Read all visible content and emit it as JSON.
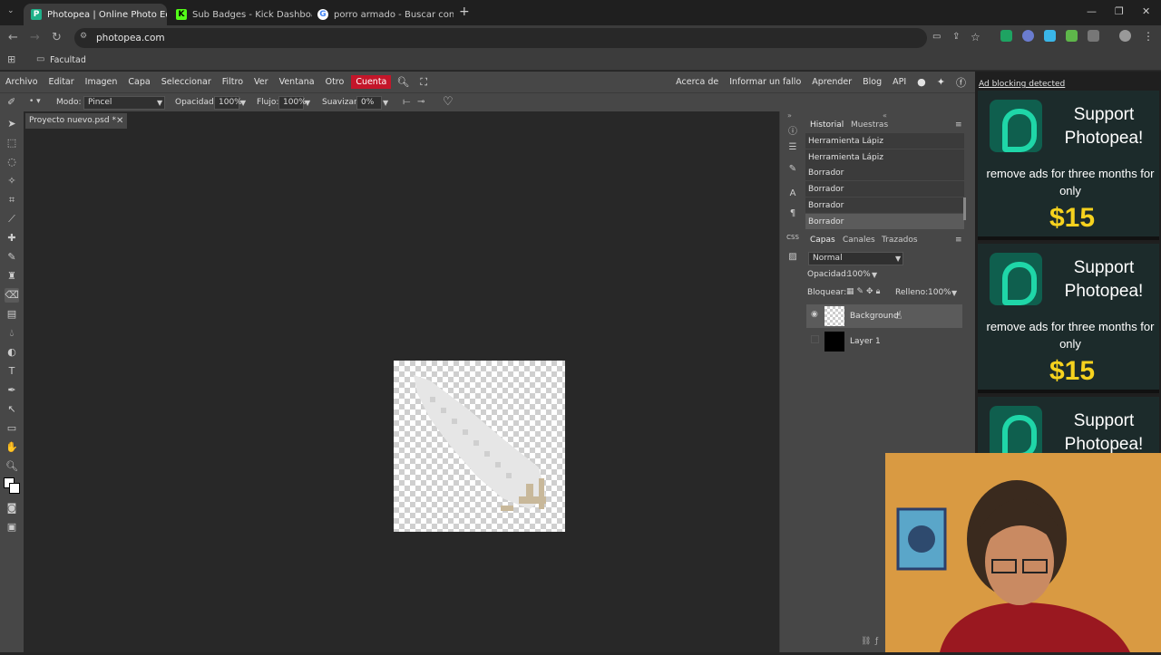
{
  "browser": {
    "tabs": [
      {
        "title": "Photopea | Online Photo Editor",
        "active": true
      },
      {
        "title": "Sub Badges - Kick Dashboard",
        "active": false
      },
      {
        "title": "porro armado - Buscar con Go",
        "active": false
      }
    ],
    "url": "photopea.com",
    "bookmark": "Facultad"
  },
  "menu": {
    "items": [
      "Archivo",
      "Editar",
      "Imagen",
      "Capa",
      "Seleccionar",
      "Filtro",
      "Ver",
      "Ventana",
      "Otro"
    ],
    "account": "Cuenta",
    "right_links": [
      "Acerca de",
      "Informar un fallo",
      "Aprender",
      "Blog",
      "API"
    ]
  },
  "options": {
    "mode_label": "Modo:",
    "mode_value": "Pincel",
    "opacity_label": "Opacidad:",
    "opacity_value": "100%",
    "flow_label": "Flujo:",
    "flow_value": "100%",
    "smooth_label": "Suavizar:",
    "smooth_value": "0%"
  },
  "document": {
    "tab_title": "Proyecto nuevo.psd *"
  },
  "history": {
    "tabs": [
      "Historial",
      "Muestras"
    ],
    "items": [
      "Herramienta Lápiz",
      "Herramienta Lápiz",
      "Borrador",
      "Borrador",
      "Borrador",
      "Borrador"
    ]
  },
  "layers": {
    "tabs": [
      "Capas",
      "Canales",
      "Trazados"
    ],
    "blend_mode": "Normal",
    "opacity_label": "Opacidad:",
    "opacity_value": "100%",
    "lock_label": "Bloquear:",
    "fill_label": "Relleno:",
    "fill_value": "100%",
    "items": [
      {
        "name": "Background",
        "selected": true,
        "visible": true
      },
      {
        "name": "Layer 1",
        "selected": false,
        "visible": false
      }
    ]
  },
  "ads": {
    "notice": "Ad blocking detected",
    "title": "Support Photopea!",
    "text": "remove ads for three months for only",
    "price": "$15"
  },
  "colors": {
    "accent": "#c4162a",
    "ad_price": "#f6d21e",
    "ad_logo": "#1fd6a8"
  }
}
